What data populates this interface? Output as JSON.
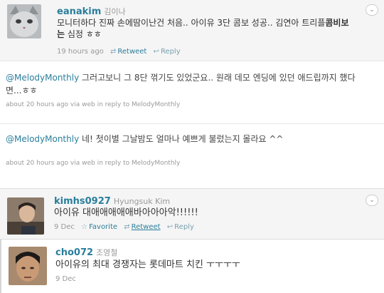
{
  "tweets": [
    {
      "screen_name": "eanakim",
      "full_name": "김이나",
      "text_before": "모니터하다 진짜 손에땀이난건 처음.. 아이유 3단 콤보 성공.. 김연아 트리플",
      "text_bold": "콤비보는",
      "text_after": "심정 ㅎㅎ",
      "time": "19 hours ago",
      "retweet_label": "Retweet",
      "reply_label": "Reply"
    },
    {
      "mention": "@MelodyMonthly",
      "text": " 그러고보니 그 8단 꺾기도 있었군요.. 원래 데모 엔딩에 있던 애드립까지 했다면...ㅎㅎ",
      "meta": "about 20 hours ago via web in reply to MelodyMonthly"
    },
    {
      "mention": "@MelodyMonthly",
      "text": " 네! 첫이별 그날밤도 얼마나 예쁘게 불렀는지 몰라요 ^^",
      "meta": "about 20 hours ago via web in reply to MelodyMonthly"
    },
    {
      "screen_name": "kimhs0927",
      "full_name": "Hyungsuk Kim",
      "text": "아이유 대애애애애애바아아아악!!!!!!",
      "time": "9 Dec",
      "favorite_label": "Favorite",
      "retweet_label": "Retweet",
      "reply_label": "Reply"
    },
    {
      "screen_name": "cho072",
      "full_name": "조영철",
      "text": "아이유의 최대 경쟁자는 롯데마트 치킨 ㅜㅜㅜㅜ",
      "time": "9 Dec"
    }
  ]
}
